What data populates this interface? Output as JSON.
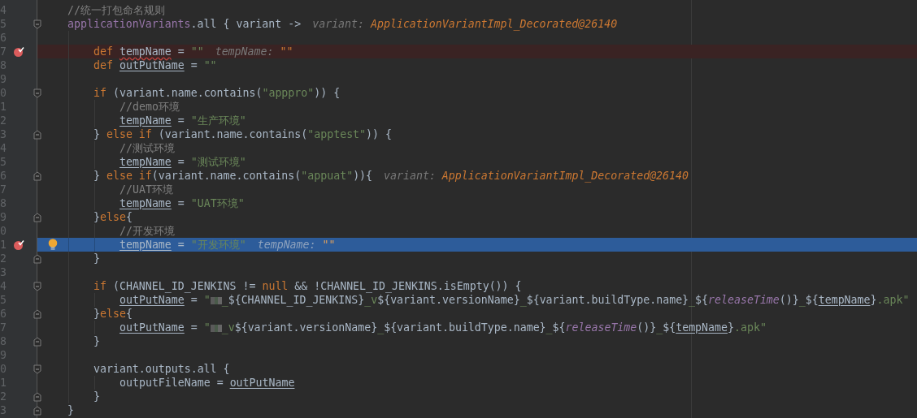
{
  "lines": [
    {
      "n": "4",
      "breakpoint": false,
      "current": false,
      "bulb": false,
      "code": [
        {
          "kind": "comment",
          "t": "//统一打包命名规则"
        }
      ]
    },
    {
      "n": "5",
      "breakpoint": false,
      "current": false,
      "bulb": false,
      "fold": {
        "kind": "open"
      },
      "code": [
        {
          "kind": "prop",
          "t": "applicationVariants"
        },
        {
          "kind": "plain",
          "t": ".all { variant ->"
        }
      ],
      "hint": {
        "name": "variant:",
        "value": "ApplicationVariantImpl_Decorated@26140"
      },
      "children": [
        {
          "n": "6",
          "breakpoint": false,
          "current": false,
          "bulb": false
        },
        {
          "n": "7",
          "breakpoint": true,
          "current": false,
          "bulb": false,
          "code": [
            {
              "kind": "kw",
              "t": "def "
            },
            {
              "kind": "typo",
              "t": "tempName"
            },
            {
              "kind": "plain",
              "t": " = "
            },
            {
              "kind": "str",
              "t": "\"\""
            }
          ],
          "hint": {
            "name": "tempName:",
            "value": "\"\""
          }
        },
        {
          "n": "8",
          "breakpoint": false,
          "current": false,
          "bulb": false,
          "code": [
            {
              "kind": "kw",
              "t": "def "
            },
            {
              "kind": "var",
              "t": "outPutName"
            },
            {
              "kind": "plain",
              "t": " = "
            },
            {
              "kind": "str",
              "t": "\"\""
            }
          ]
        },
        {
          "n": "9",
          "breakpoint": false,
          "current": false,
          "bulb": false
        },
        {
          "n": "0",
          "breakpoint": false,
          "current": false,
          "bulb": false,
          "fold": {
            "kind": "open"
          },
          "code": [
            {
              "kind": "kw",
              "t": "if"
            },
            {
              "kind": "plain",
              "t": " (variant.name.contains("
            },
            {
              "kind": "str",
              "t": "\"apppro\""
            },
            {
              "kind": "plain",
              "t": ")) {"
            }
          ],
          "children": [
            {
              "n": "1",
              "breakpoint": false,
              "current": false,
              "bulb": false,
              "code": [
                {
                  "kind": "comment",
                  "t": "//demo环境"
                }
              ]
            },
            {
              "n": "2",
              "breakpoint": false,
              "current": false,
              "bulb": false,
              "code": [
                {
                  "kind": "var",
                  "t": "tempName"
                },
                {
                  "kind": "plain",
                  "t": " = "
                },
                {
                  "kind": "str",
                  "t": "\"生产环境\""
                }
              ]
            }
          ]
        },
        {
          "n": "3",
          "breakpoint": false,
          "current": false,
          "bulb": false,
          "fold": {
            "kind": "close"
          },
          "code": [
            {
              "kind": "plain",
              "t": "} "
            },
            {
              "kind": "kw",
              "t": "else if"
            },
            {
              "kind": "plain",
              "t": " (variant.name.contains("
            },
            {
              "kind": "str",
              "t": "\"apptest\""
            },
            {
              "kind": "plain",
              "t": ")) {"
            }
          ],
          "children": [
            {
              "n": "4",
              "breakpoint": false,
              "current": false,
              "bulb": false,
              "code": [
                {
                  "kind": "comment",
                  "t": "//测试环境"
                }
              ]
            },
            {
              "n": "5",
              "breakpoint": false,
              "current": false,
              "bulb": false,
              "code": [
                {
                  "kind": "var",
                  "t": "tempName"
                },
                {
                  "kind": "plain",
                  "t": " = "
                },
                {
                  "kind": "str",
                  "t": "\"测试环境\""
                }
              ]
            }
          ]
        },
        {
          "n": "6",
          "breakpoint": false,
          "current": false,
          "bulb": false,
          "fold": {
            "kind": "close"
          },
          "code": [
            {
              "kind": "plain",
              "t": "} "
            },
            {
              "kind": "kw",
              "t": "else if"
            },
            {
              "kind": "plain",
              "t": "(variant.name.contains("
            },
            {
              "kind": "str",
              "t": "\"appuat\""
            },
            {
              "kind": "plain",
              "t": ")){"
            }
          ],
          "hint": {
            "name": "variant:",
            "value": "ApplicationVariantImpl_Decorated@26140"
          },
          "children": [
            {
              "n": "7",
              "breakpoint": false,
              "current": false,
              "bulb": false,
              "code": [
                {
                  "kind": "comment",
                  "t": "//UAT环境"
                }
              ]
            },
            {
              "n": "8",
              "breakpoint": false,
              "current": false,
              "bulb": false,
              "code": [
                {
                  "kind": "var",
                  "t": "tempName"
                },
                {
                  "kind": "plain",
                  "t": " = "
                },
                {
                  "kind": "str",
                  "t": "\"UAT环境\""
                }
              ]
            }
          ]
        },
        {
          "n": "9",
          "breakpoint": false,
          "current": false,
          "bulb": false,
          "fold": {
            "kind": "close"
          },
          "code": [
            {
              "kind": "plain",
              "t": "}"
            },
            {
              "kind": "kw",
              "t": "else"
            },
            {
              "kind": "plain",
              "t": "{"
            }
          ],
          "children": [
            {
              "n": "0",
              "breakpoint": false,
              "current": false,
              "bulb": false,
              "code": [
                {
                  "kind": "comment",
                  "t": "//开发环境"
                }
              ]
            },
            {
              "n": "1",
              "breakpoint": true,
              "current": true,
              "bulb": true,
              "code": [
                {
                  "kind": "var",
                  "t": "tempName"
                },
                {
                  "kind": "plain",
                  "t": " = "
                },
                {
                  "kind": "str",
                  "t": "\"开发环境\""
                }
              ],
              "hint": {
                "name": "tempName:",
                "value": "\"\""
              }
            }
          ]
        },
        {
          "n": "2",
          "breakpoint": false,
          "current": false,
          "bulb": false,
          "fold": {
            "kind": "close"
          },
          "code": [
            {
              "kind": "plain",
              "t": "}"
            }
          ]
        },
        {
          "n": "3",
          "breakpoint": false,
          "current": false,
          "bulb": false
        },
        {
          "n": "4",
          "breakpoint": false,
          "current": false,
          "bulb": false,
          "fold": {
            "kind": "open"
          },
          "code": [
            {
              "kind": "kw",
              "t": "if"
            },
            {
              "kind": "plain",
              "t": " (CHANNEL_ID_JENKINS != "
            },
            {
              "kind": "kw",
              "t": "null"
            },
            {
              "kind": "plain",
              "t": " && !CHANNEL_ID_JENKINS.isEmpty()) {"
            }
          ],
          "children": [
            {
              "n": "5",
              "breakpoint": false,
              "current": false,
              "bulb": false,
              "code": [
                {
                  "kind": "var",
                  "t": "outPutName"
                },
                {
                  "kind": "plain",
                  "t": " = "
                },
                {
                  "kind": "str",
                  "t": "\""
                },
                {
                  "kind": "blur"
                },
                {
                  "kind": "str",
                  "t": "_"
                },
                {
                  "kind": "plain",
                  "t": "${CHANNEL_ID_JENKINS}"
                },
                {
                  "kind": "str",
                  "t": "_v"
                },
                {
                  "kind": "plain",
                  "t": "${variant.versionName}"
                },
                {
                  "kind": "str",
                  "t": "_"
                },
                {
                  "kind": "plain",
                  "t": "${variant.buildType.name}"
                },
                {
                  "kind": "str",
                  "t": "_"
                },
                {
                  "kind": "plain",
                  "t": "${"
                },
                {
                  "kind": "fn",
                  "t": "releaseTime"
                },
                {
                  "kind": "plain",
                  "t": "()}"
                },
                {
                  "kind": "str",
                  "t": "_"
                },
                {
                  "kind": "plain",
                  "t": "${"
                },
                {
                  "kind": "var",
                  "t": "tempName"
                },
                {
                  "kind": "plain",
                  "t": "}"
                },
                {
                  "kind": "str",
                  "t": ".apk\""
                }
              ]
            }
          ]
        },
        {
          "n": "6",
          "breakpoint": false,
          "current": false,
          "bulb": false,
          "fold": {
            "kind": "close"
          },
          "code": [
            {
              "kind": "plain",
              "t": "}"
            },
            {
              "kind": "kw",
              "t": "else"
            },
            {
              "kind": "plain",
              "t": "{"
            }
          ],
          "children": [
            {
              "n": "7",
              "breakpoint": false,
              "current": false,
              "bulb": false,
              "code": [
                {
                  "kind": "var",
                  "t": "outPutName"
                },
                {
                  "kind": "plain",
                  "t": " = "
                },
                {
                  "kind": "str",
                  "t": "\""
                },
                {
                  "kind": "blur"
                },
                {
                  "kind": "str",
                  "t": "_v"
                },
                {
                  "kind": "plain",
                  "t": "${variant.versionName}"
                },
                {
                  "kind": "str",
                  "t": "_"
                },
                {
                  "kind": "plain",
                  "t": "${variant.buildType.name}"
                },
                {
                  "kind": "str",
                  "t": "_"
                },
                {
                  "kind": "plain",
                  "t": "${"
                },
                {
                  "kind": "fn",
                  "t": "releaseTime"
                },
                {
                  "kind": "plain",
                  "t": "()}"
                },
                {
                  "kind": "str",
                  "t": "_"
                },
                {
                  "kind": "plain",
                  "t": "${"
                },
                {
                  "kind": "var",
                  "t": "tempName"
                },
                {
                  "kind": "plain",
                  "t": "}"
                },
                {
                  "kind": "str",
                  "t": ".apk\""
                }
              ]
            }
          ]
        },
        {
          "n": "8",
          "breakpoint": false,
          "current": false,
          "bulb": false,
          "fold": {
            "kind": "close"
          },
          "code": [
            {
              "kind": "plain",
              "t": "}"
            }
          ]
        },
        {
          "n": "9",
          "breakpoint": false,
          "current": false,
          "bulb": false
        },
        {
          "n": "0",
          "breakpoint": false,
          "current": false,
          "bulb": false,
          "fold": {
            "kind": "open"
          },
          "code": [
            {
              "kind": "plain",
              "t": "variant.outputs.all {"
            }
          ],
          "children": [
            {
              "n": "1",
              "breakpoint": false,
              "current": false,
              "bulb": false,
              "code": [
                {
                  "kind": "plain",
                  "t": "outputFileName = "
                },
                {
                  "kind": "var",
                  "t": "outPutName"
                }
              ]
            }
          ]
        },
        {
          "n": "2",
          "breakpoint": false,
          "current": false,
          "bulb": false,
          "fold": {
            "kind": "close"
          },
          "code": [
            {
              "kind": "plain",
              "t": "}"
            }
          ]
        }
      ]
    },
    {
      "n": "3",
      "breakpoint": false,
      "current": false,
      "bulb": false,
      "fold": {
        "kind": "close"
      },
      "code": [
        {
          "kind": "plain",
          "t": "}"
        }
      ]
    }
  ]
}
